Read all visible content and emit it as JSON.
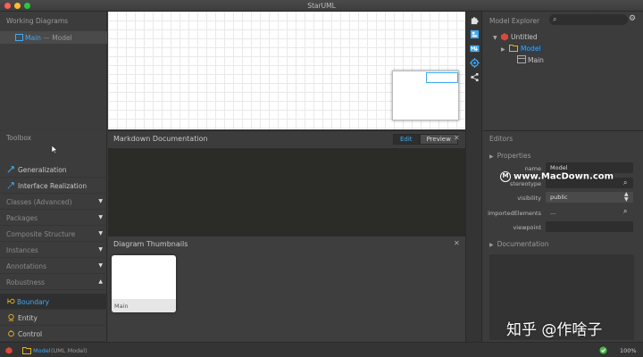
{
  "window": {
    "title": "StarUML"
  },
  "working_diagrams": {
    "header": "Working Diagrams",
    "item": {
      "name": "Main",
      "sep": "—",
      "owner": "Model"
    }
  },
  "model_explorer": {
    "header": "Model Explorer",
    "search_placeholder": "",
    "tree": [
      {
        "label": "Untitled",
        "level": 0
      },
      {
        "label": "Model",
        "level": 1
      },
      {
        "label": "Main",
        "level": 2
      }
    ]
  },
  "toolbox": {
    "header": "Toolbox",
    "items_top": [
      "Generalization",
      "Interface Realization"
    ],
    "sections": [
      {
        "label": "Classes (Advanced)",
        "arrow": "▼"
      },
      {
        "label": "Packages",
        "arrow": "▼"
      },
      {
        "label": "Composite Structure",
        "arrow": "▼"
      },
      {
        "label": "Instances",
        "arrow": "▼"
      },
      {
        "label": "Annotations",
        "arrow": "▼"
      },
      {
        "label": "Robustness",
        "arrow": "▲"
      }
    ],
    "items_bottom": [
      "Boundary",
      "Entity",
      "Control"
    ]
  },
  "markdown": {
    "header": "Markdown Documentation",
    "tab_edit": "Edit",
    "tab_preview": "Preview",
    "close": "✕"
  },
  "thumbnails": {
    "header": "Diagram Thumbnails",
    "close": "✕",
    "card_label": "Main"
  },
  "editors": {
    "header": "Editors",
    "properties_label": "Properties",
    "props": [
      {
        "label": "name",
        "value": "Model"
      },
      {
        "label": "stereotype",
        "value": ""
      },
      {
        "label": "visibility",
        "value": "public"
      },
      {
        "label": "importedElements",
        "value": "..."
      },
      {
        "label": "viewpoint",
        "value": ""
      }
    ],
    "documentation_label": "Documentation"
  },
  "status": {
    "model_label": "Model",
    "model_type": "(UML Model)",
    "zoom": "100%"
  },
  "watermarks": {
    "macdown": "www.MacDown.com",
    "zhihu": "知乎 @作啥子"
  },
  "colors": {
    "accent": "#3fa9f5",
    "panel": "#3c3c3c",
    "canvas": "#ffffff"
  }
}
